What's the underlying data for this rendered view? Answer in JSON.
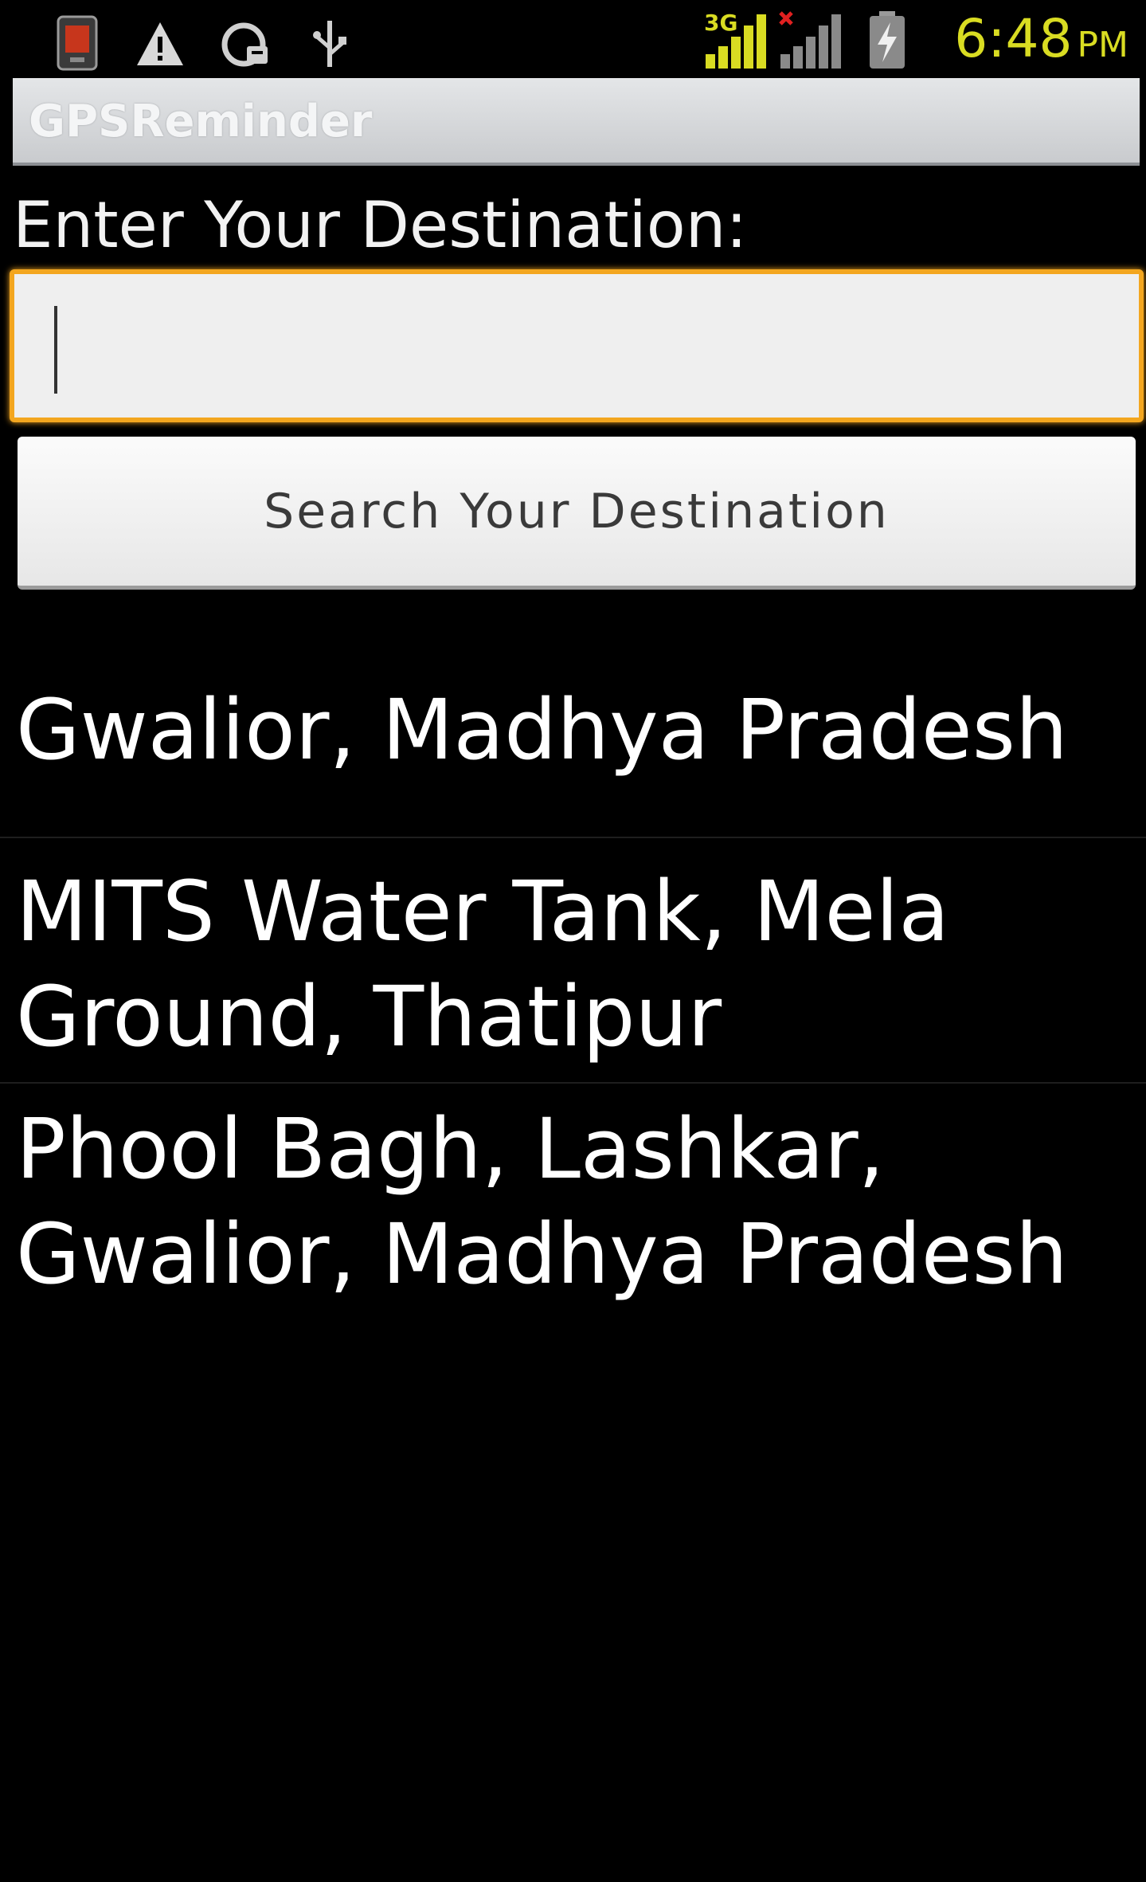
{
  "status_bar": {
    "left_icons": [
      "app-notification-icon",
      "warning-icon",
      "sync-icon",
      "usb-icon"
    ],
    "network_label": "3G",
    "time": "6:48",
    "ampm": "PM",
    "time_color": "#d9dc22"
  },
  "app": {
    "title": "GPSReminder"
  },
  "form": {
    "label": "Enter Your Destination:",
    "input_value": "",
    "input_placeholder": "",
    "search_button_label": "Search Your Destination",
    "input_focus_color": "#f3a61f"
  },
  "results": [
    {
      "label": "Gwalior, Madhya Pradesh"
    },
    {
      "label": "MITS Water Tank, Mela Ground, Thatipur"
    },
    {
      "label": "Phool Bagh, Lashkar, Gwalior, Madhya Pradesh"
    }
  ]
}
